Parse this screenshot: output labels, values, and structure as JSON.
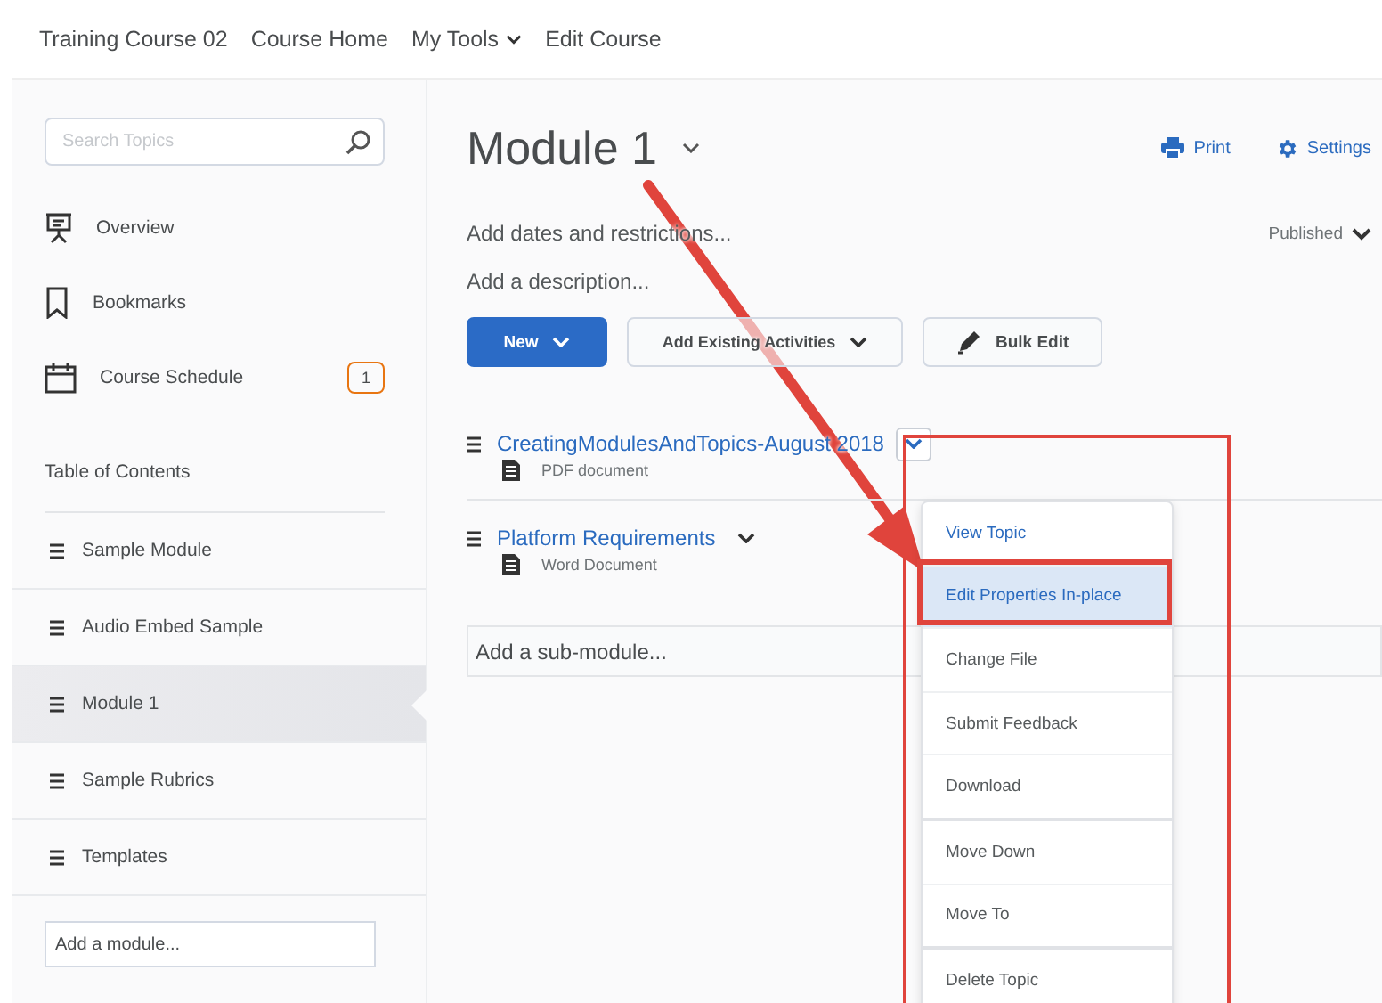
{
  "nav": [
    {
      "label": "Training Course 02",
      "kind": "link"
    },
    {
      "label": "Course Home",
      "kind": "link"
    },
    {
      "label": "My Tools",
      "kind": "menu"
    },
    {
      "label": "Edit Course",
      "kind": "link"
    }
  ],
  "sidebar": {
    "search": {
      "placeholder": "Search Topics"
    },
    "links": [
      {
        "label": "Overview",
        "kind": "overview"
      },
      {
        "label": "Bookmarks",
        "kind": "bookmark"
      },
      {
        "label": "Course Schedule",
        "kind": "schedule",
        "badge": "1"
      }
    ],
    "toc_title": "Table of Contents",
    "modules": [
      {
        "label": "Sample Module",
        "selected": false
      },
      {
        "label": "Audio Embed Sample",
        "selected": false
      },
      {
        "label": "Module 1",
        "selected": true
      },
      {
        "label": "Sample Rubrics",
        "selected": false
      },
      {
        "label": "Templates",
        "selected": false
      }
    ],
    "add_module": {
      "placeholder": "Add a module..."
    }
  },
  "main": {
    "title": "Module 1",
    "actions": [
      {
        "label": "Print",
        "kind": "print"
      },
      {
        "label": "Settings",
        "kind": "settings"
      }
    ],
    "dates": "Add dates and restrictions...",
    "status": "Published",
    "description": "Add a description...",
    "buttons": [
      {
        "label": "New",
        "kind": "primary"
      },
      {
        "label": "Add Existing Activities",
        "kind": "dropdown"
      },
      {
        "label": "Bulk Edit",
        "kind": "edit"
      }
    ],
    "topics": [
      {
        "title": "CreatingModulesAndTopics-August 2018",
        "type": "PDF document",
        "menu_open": true
      },
      {
        "title": "Platform Requirements",
        "type": "Word Document",
        "menu_open": false
      }
    ],
    "add_submodule": {
      "placeholder": "Add a sub-module..."
    }
  },
  "context_menu": [
    {
      "label": "View Topic",
      "selected": false
    },
    {
      "label": "Edit Properties In-place",
      "selected": true
    },
    {
      "label": "Change File",
      "selected": false
    },
    {
      "label": "Submit Feedback",
      "selected": false
    },
    {
      "label": "Download",
      "selected": false
    },
    {
      "label": "Move Down",
      "selected": false
    },
    {
      "label": "Move To",
      "selected": false
    },
    {
      "label": "Delete Topic",
      "selected": false
    }
  ]
}
